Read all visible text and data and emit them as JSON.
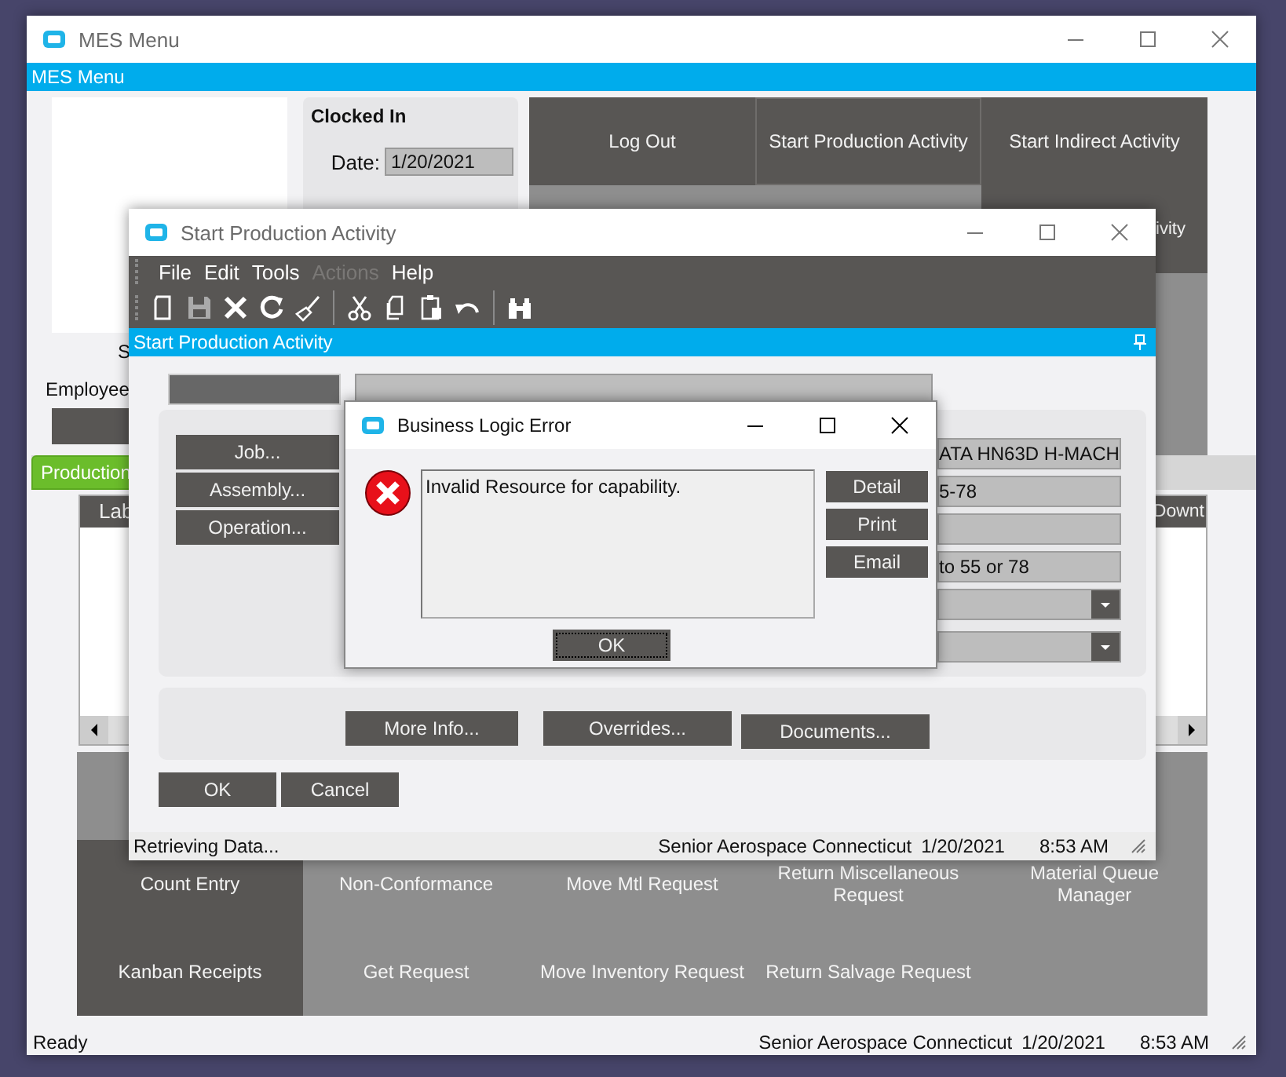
{
  "main_window": {
    "title": "MES Menu",
    "banner": "MES Menu",
    "clock": {
      "heading": "Clocked In",
      "date_label": "Date:",
      "date": "1/20/2021"
    },
    "top_tiles": [
      {
        "label": "Log Out",
        "selected": false
      },
      {
        "label": "Start Production Activity",
        "selected": true
      },
      {
        "label": "Start Indirect Activity",
        "selected": false
      },
      {
        "label": "ivity",
        "selected": false
      }
    ],
    "side_labels": [
      "S",
      "Employee"
    ],
    "tabs": [
      {
        "label": "Production",
        "selected": true
      }
    ],
    "table": {
      "columns": [
        "Lab",
        "Downt"
      ]
    },
    "bottom_tiles": [
      {
        "label": "Count Entry",
        "disabled": false
      },
      {
        "label": "Non-Conformance",
        "disabled": true
      },
      {
        "label": "Move Mtl Request",
        "disabled": true
      },
      {
        "label": "Return Miscellaneous Request",
        "disabled": true
      },
      {
        "label": "Material Queue Manager",
        "disabled": true
      },
      {
        "label": "Kanban Receipts",
        "disabled": false
      },
      {
        "label": "Get Request",
        "disabled": true
      },
      {
        "label": "Move Inventory Request",
        "disabled": true
      },
      {
        "label": "Return Salvage Request",
        "disabled": true
      }
    ],
    "status_bar": {
      "message": "Ready",
      "company": "Senior Aerospace Connecticut",
      "date": "1/20/2021",
      "time": "8:53 AM"
    }
  },
  "activity_window": {
    "title": "Start Production Activity",
    "menu": [
      {
        "label": "File",
        "disabled": false
      },
      {
        "label": "Edit",
        "disabled": false
      },
      {
        "label": "Tools",
        "disabled": false
      },
      {
        "label": "Actions",
        "disabled": true
      },
      {
        "label": "Help",
        "disabled": false
      }
    ],
    "banner": "Start Production Activity",
    "left_buttons": [
      "Job...",
      "Assembly...",
      "Operation..."
    ],
    "fields": [
      {
        "kind": "text",
        "value": "ATA HN63D H-MACH"
      },
      {
        "kind": "text",
        "value": "5-78"
      },
      {
        "kind": "text"
      },
      {
        "kind": "text",
        "value": "to 55 or 78"
      },
      {
        "kind": "dropdown"
      },
      {
        "kind": "dropdown"
      }
    ],
    "info_buttons": [
      "More Info...",
      "Overrides...",
      "Documents..."
    ],
    "buttons": [
      "OK",
      "Cancel"
    ],
    "status_bar": {
      "message": "Retrieving Data...",
      "company": "Senior Aerospace Connecticut",
      "date": "1/20/2021",
      "time": "8:53 AM"
    }
  },
  "error_dialog": {
    "title": "Business Logic Error",
    "message": "Invalid Resource for capability.",
    "side_buttons": [
      "Detail",
      "Print",
      "Email"
    ],
    "ok": "OK"
  }
}
